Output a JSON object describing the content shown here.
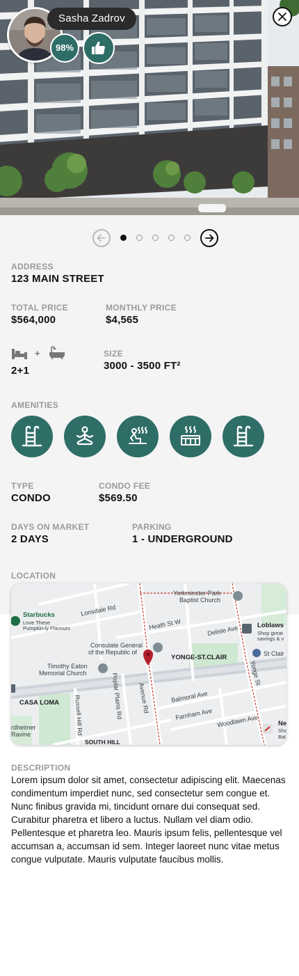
{
  "agent": {
    "name": "Sasha Zadrov",
    "rating": "98%"
  },
  "icons": {
    "close": "close-icon",
    "like": "thumbs-up-icon",
    "prev": "arrow-left-icon",
    "next": "arrow-right-icon",
    "bed": "bed-icon",
    "bath": "bathtub-icon",
    "map_pin": "map-pin-icon"
  },
  "carousel": {
    "count": 5,
    "active_index": 0
  },
  "details": {
    "address_label": "ADDRESS",
    "address": "123 MAIN STREET",
    "total_price_label": "TOTAL PRICE",
    "total_price": "$564,000",
    "monthly_price_label": "MONTHLY PRICE",
    "monthly_price": "$4,565",
    "plus": "+",
    "rooms": "2+1",
    "size_label": "SIZE",
    "size": "3000 - 3500 FT²",
    "amenities_label": "AMENITIES",
    "amenities": [
      "pool-ladder-icon",
      "yoga-meditation-icon",
      "sauna-icon",
      "hot-tub-icon",
      "pool-ladder-icon"
    ],
    "type_label": "TYPE",
    "type": "CONDO",
    "condo_fee_label": "CONDO FEE",
    "condo_fee": "$569.50",
    "days_label": "DAYS ON MARKET",
    "days": "2 DAYS",
    "parking_label": "PARKING",
    "parking": "1 - UNDERGROUND",
    "location_label": "LOCATION",
    "description_label": "DESCRIPTION",
    "description": "Lorem ipsum dolor sit amet, consectetur adipiscing elit. Maecenas condimentum imperdiet nunc, sed consectetur sem congue et. Nunc finibus gravida mi, tincidunt ornare dui consequat sed. Curabitur pharetra et libero a luctus. Nullam vel diam odio. Pellentesque et pharetra leo. Mauris ipsum felis, pellentesque vel accumsan a, accumsan id sem. Integer laoreet nunc vitae metus congue vulputate. Mauris vulputate faucibus mollis."
  },
  "map": {
    "labels": {
      "yorkminster1": "Yorkminster Park",
      "yorkminster2": "Baptist Church",
      "starbucks": "Starbucks",
      "starbucks_sub1": "Love These",
      "starbucks_sub2": "Pumpkin-ly Flavours",
      "lonsdale": "Lonsdale Rd",
      "heath": "Heath St W",
      "delisle": "Delisle Ave",
      "loblaws": "Loblaws",
      "loblaws_sub1": "Shop great",
      "loblaws_sub2": "savings & v",
      "consulate1": "Consulate General",
      "consulate2": "of the Republic of",
      "yonge_stclair": "YONGE-ST.CLAIR",
      "st_clair": "St Clair",
      "timothy1": "Timothy Eaton",
      "timothy2": "Memorial Church",
      "avenue": "Avenue Rd",
      "yonge": "Yonge St",
      "poplar": "Poplar Plains Rd",
      "russell": "Russell Hill Rd",
      "casa": "CASA LOMA",
      "balmoral": "Balmoral Ave",
      "farnham": "Farnham Ave",
      "woodlawn": "Woodlawn Ave",
      "rdheimer": "rdheimer",
      "ravine": "Ravine",
      "south_hill": "SOUTH HILL",
      "ne": "Ne",
      "sho": "Sho",
      "bal": "Bal"
    }
  }
}
